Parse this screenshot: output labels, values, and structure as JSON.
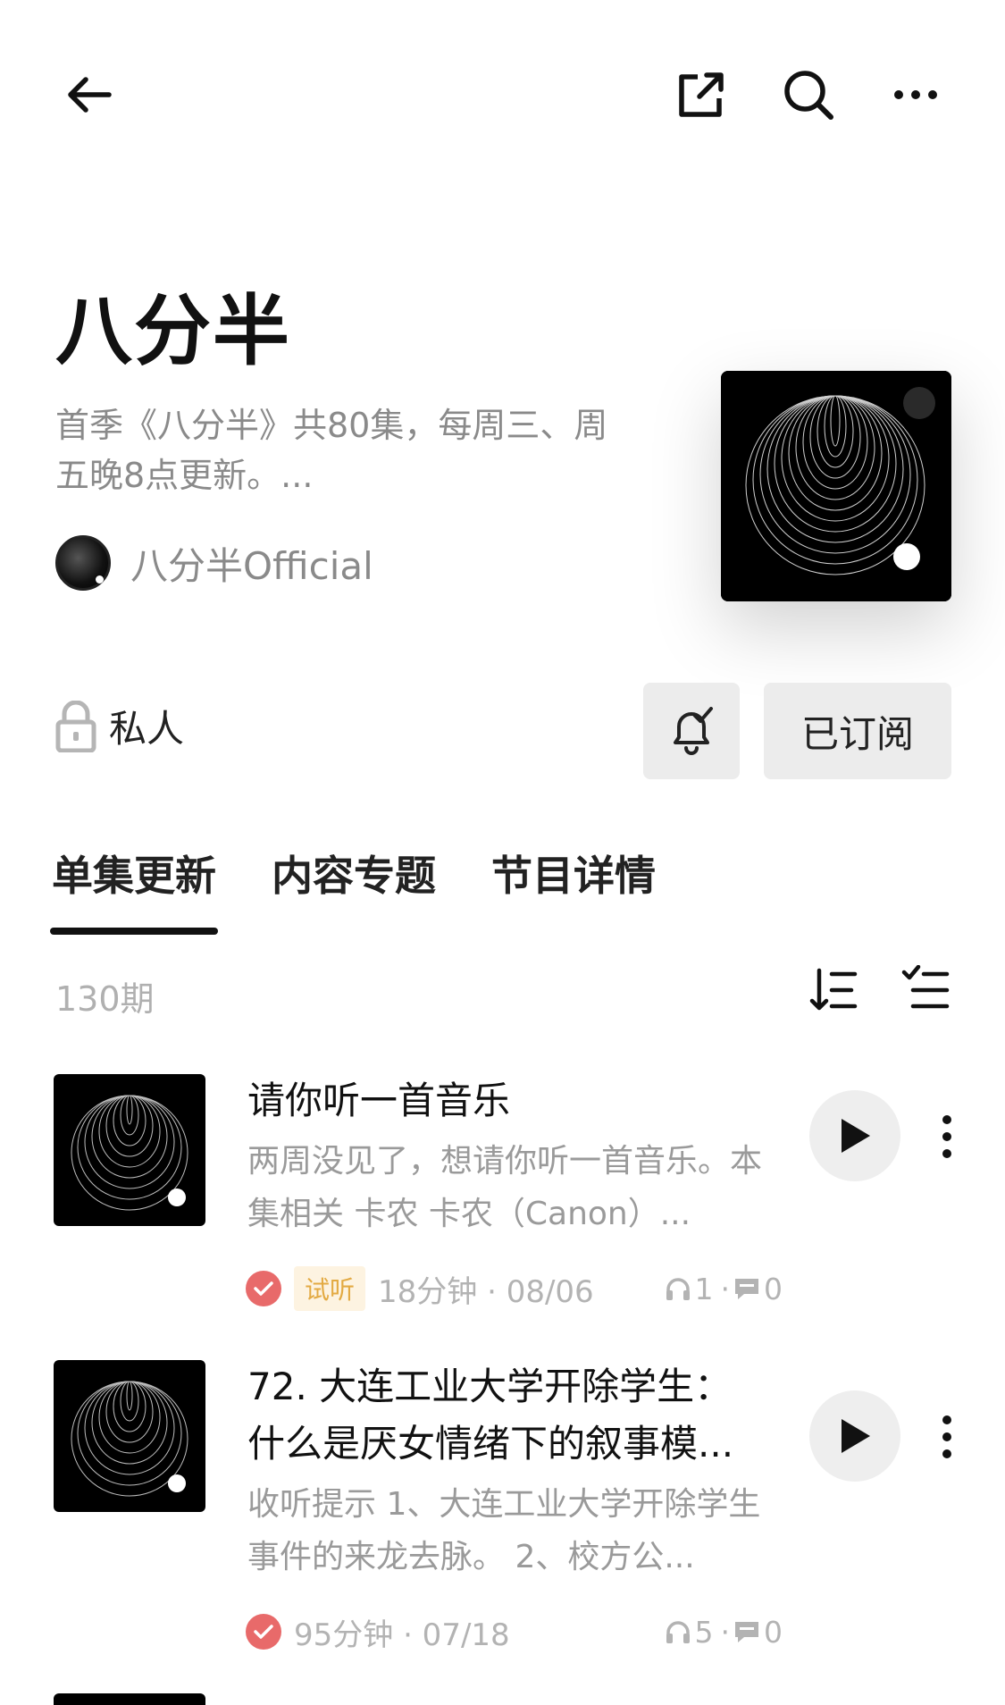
{
  "header": {
    "title": "八分半",
    "description": "首季《八分半》共80集，每周三、周五晚8点更新。...",
    "author": "八分半Official"
  },
  "actions": {
    "privacy_label": "私人",
    "subscribe_label": "已订阅"
  },
  "tabs": [
    {
      "label": "单集更新",
      "active": true
    },
    {
      "label": "内容专题",
      "active": false
    },
    {
      "label": "节目详情",
      "active": false
    }
  ],
  "list": {
    "count_label": "130期"
  },
  "episodes": [
    {
      "title": "请你听一首音乐",
      "description": "两周没见了，想请你听一首音乐。本集相关 卡农 卡农（Canon）...",
      "badge": "试听",
      "duration_date": "18分钟 · 08/06",
      "plays": "1",
      "sep": "·",
      "comments": "0"
    },
    {
      "title": "72. 大连工业大学开除学生：什么是厌女情绪下的叙事模...",
      "description": "收听提示 1、大连工业大学开除学生事件的来龙去脉。 2、校方公...",
      "badge": "",
      "duration_date": "95分钟 · 07/18",
      "plays": "5",
      "sep": "·",
      "comments": "0"
    }
  ],
  "colors": {
    "accent_check": "#e86a6a",
    "badge_bg": "#fdf3e1",
    "badge_text": "#e3aa43",
    "button_bg": "#ececec"
  },
  "icons": [
    "back-arrow-icon",
    "share-icon",
    "search-icon",
    "more-icon",
    "lock-icon",
    "bell-check-icon",
    "sort-icon",
    "filter-check-icon",
    "play-icon",
    "kebab-icon",
    "headphones-icon",
    "comment-icon",
    "check-icon"
  ]
}
